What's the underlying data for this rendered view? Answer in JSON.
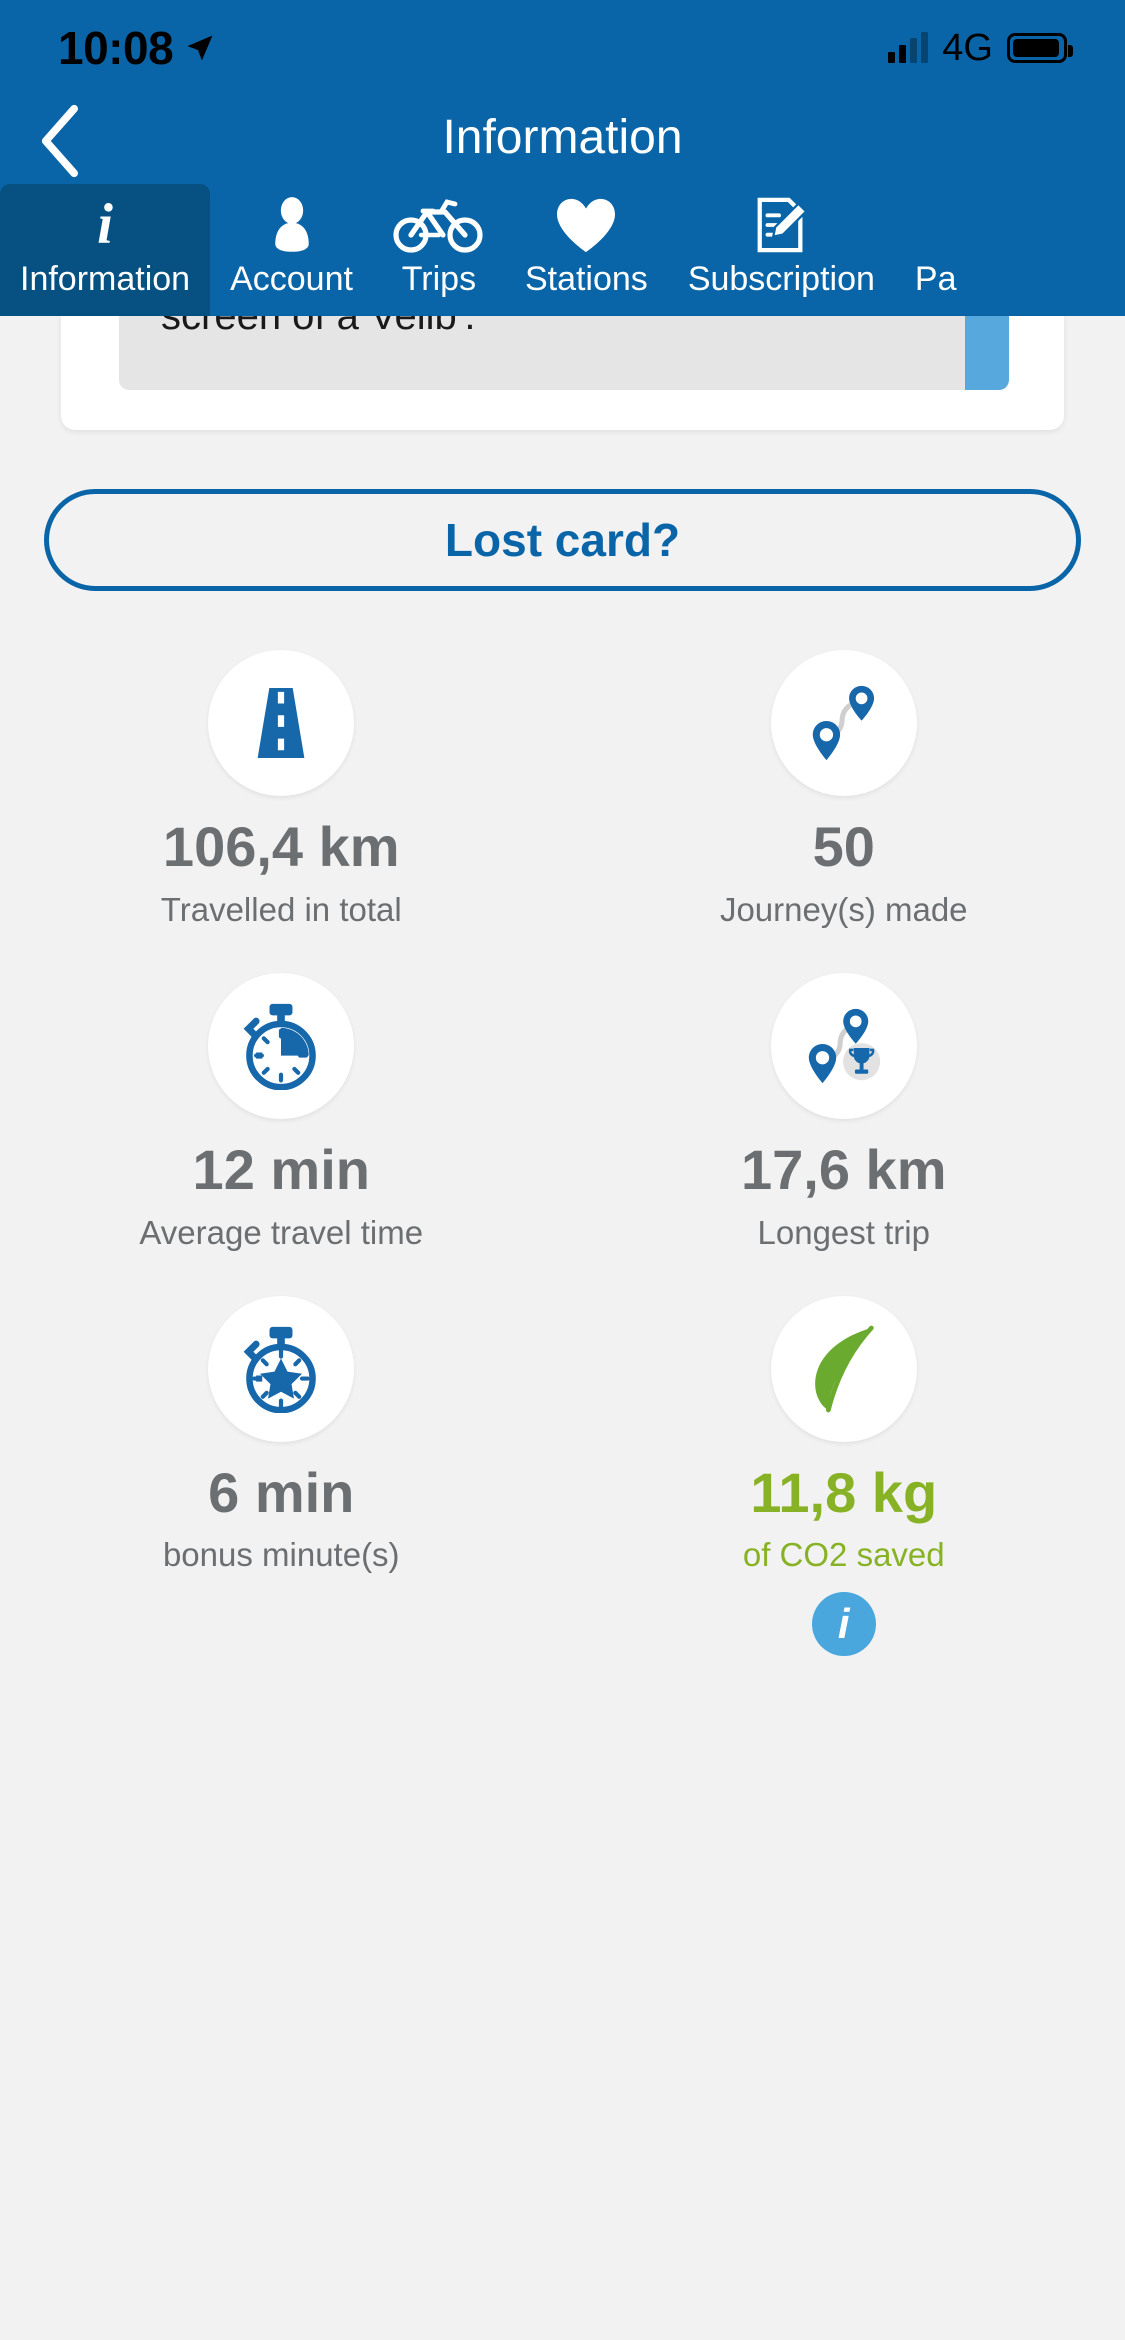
{
  "status_bar": {
    "time": "10:08",
    "location_icon": "location-arrow-icon",
    "network": "4G",
    "signal_icon": "signal-bars-icon",
    "battery_icon": "battery-full-icon"
  },
  "nav": {
    "back_icon": "chevron-left-icon",
    "title": "Information"
  },
  "tabs": [
    {
      "label": "Information",
      "icon": "info-italic-icon",
      "active": true
    },
    {
      "label": "Account",
      "icon": "person-icon",
      "active": false
    },
    {
      "label": "Trips",
      "icon": "bicycle-icon",
      "active": false
    },
    {
      "label": "Stations",
      "icon": "heart-icon",
      "active": false
    },
    {
      "label": "Subscription",
      "icon": "document-pencil-icon",
      "active": false
    },
    {
      "label": "Pa",
      "icon": "",
      "active": false
    }
  ],
  "info_card": {
    "text": "screen of a Velib'.",
    "scrollbar_color": "#56a8dd"
  },
  "lost_card_button": {
    "label": "Lost card?"
  },
  "stats": [
    {
      "icon": "road-icon",
      "value": "106,4 km",
      "label": "Travelled in total",
      "color": "gray"
    },
    {
      "icon": "route-pins-icon",
      "value": "50",
      "label": "Journey(s) made",
      "color": "gray"
    },
    {
      "icon": "stopwatch-icon",
      "value": "12 min",
      "label": "Average travel time",
      "color": "gray"
    },
    {
      "icon": "route-trophy-icon",
      "value": "17,6 km",
      "label": "Longest trip",
      "color": "gray"
    },
    {
      "icon": "stopwatch-star-icon",
      "value": "6 min",
      "label": "bonus minute(s)",
      "color": "gray"
    },
    {
      "icon": "leaf-icon",
      "value": "11,8 kg",
      "label": "of CO2 saved",
      "color": "green",
      "badge": "i"
    }
  ],
  "colors": {
    "brand_blue": "#0a65a8",
    "brand_blue_dark": "#075182",
    "accent_light_blue": "#4aa7dd",
    "eco_green": "#88b225",
    "text_gray": "#6b6f72",
    "page_bg": "#f2f2f2"
  }
}
